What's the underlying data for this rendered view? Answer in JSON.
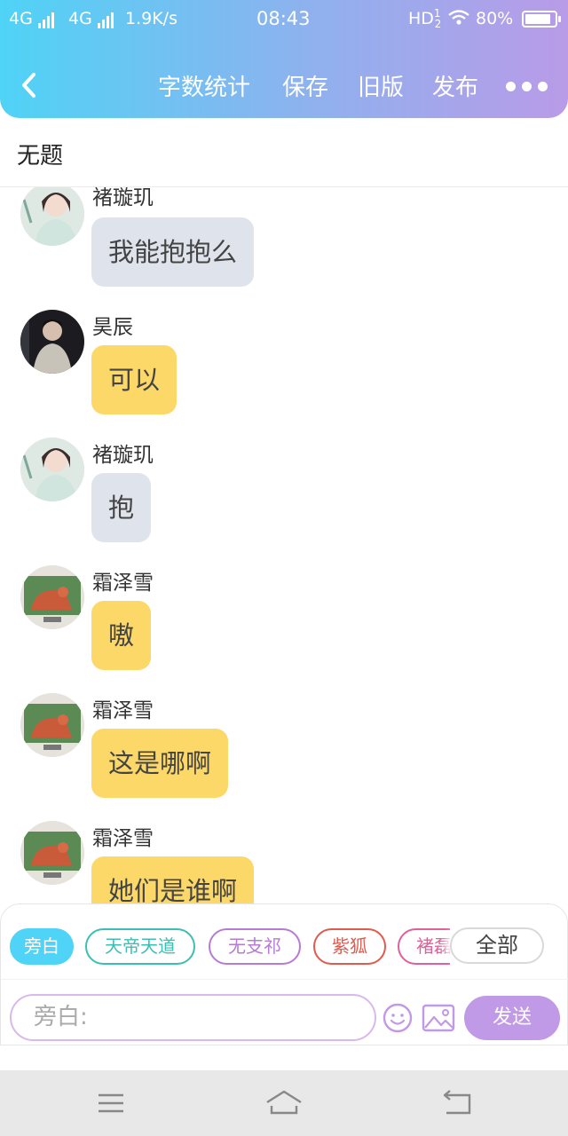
{
  "status_bar": {
    "network1": "4G",
    "network2": "4G",
    "speed": "1.9K/s",
    "time": "08:43",
    "hd": "HD",
    "hd_sup": "1",
    "hd_sub": "2",
    "battery": "80%"
  },
  "header": {
    "back_icon": "chevron-left-icon",
    "actions": [
      "字数统计",
      "保存",
      "旧版",
      "发布"
    ],
    "more_icon": "more-dots-icon"
  },
  "document": {
    "title": "无题"
  },
  "messages": [
    {
      "sender": "褚璇玑",
      "text": "我能抱抱么",
      "style": "gray"
    },
    {
      "sender": "昊辰",
      "text": "可以",
      "style": "yellow"
    },
    {
      "sender": "褚璇玑",
      "text": "抱",
      "style": "gray"
    },
    {
      "sender": "霜泽雪",
      "text": "嗷",
      "style": "yellow"
    },
    {
      "sender": "霜泽雪",
      "text": "这是哪啊",
      "style": "yellow"
    },
    {
      "sender": "霜泽雪",
      "text": "她们是谁啊",
      "style": "yellow"
    }
  ],
  "role_chips": [
    {
      "label": "旁白",
      "color": "#4fd3f6",
      "active": true
    },
    {
      "label": "天帝天道",
      "color": "#3cbfb3",
      "active": false
    },
    {
      "label": "无支祁",
      "color": "#b77bd6",
      "active": false
    },
    {
      "label": "紫狐",
      "color": "#e05a4e",
      "active": false
    },
    {
      "label": "褚磊",
      "color": "#e0609a",
      "active": false
    }
  ],
  "all_chip": "全部",
  "composer": {
    "placeholder": "旁白:",
    "emoji_icon": "smiley-icon",
    "image_icon": "image-icon",
    "send_label": "发送"
  },
  "colors": {
    "gradient_start": "#4fd3f6",
    "gradient_end": "#b99be8",
    "bubble_gray": "#dfe4ec",
    "bubble_yellow": "#fcd869",
    "send_button": "#c09ae6"
  },
  "system_nav": {
    "menu_icon": "menu-icon",
    "home_icon": "home-icon",
    "back_icon": "back-arrow-icon"
  }
}
